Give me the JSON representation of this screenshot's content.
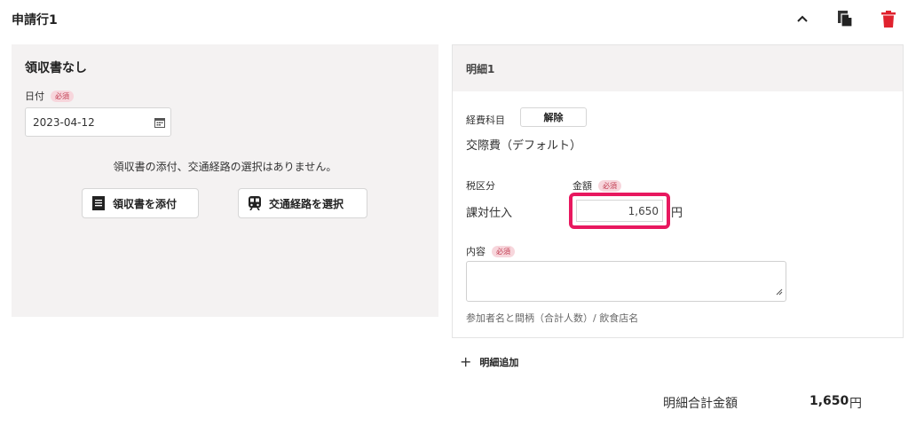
{
  "header": {
    "title": "申請行1",
    "icons": [
      "chevron-up-icon",
      "copy-icon",
      "trash-icon"
    ],
    "delete_color": "#e0222e"
  },
  "left": {
    "title": "領収書なし",
    "date_label": "日付",
    "required_badge": "必須",
    "date_value": "2023-04-12",
    "message": "領収書の添付、交通経路の選択はありません。",
    "attach_button": "領収書を添付",
    "route_button": "交通経路を選択"
  },
  "right": {
    "title": "明細1",
    "expense_label": "経費科目",
    "clear_button": "解除",
    "expense_value": "交際費（デフォルト）",
    "tax_label": "税区分",
    "amount_label": "金額",
    "required_badge": "必須",
    "tax_value": "課対仕入",
    "amount_value": "1,650",
    "amount_unit": "円",
    "highlight_color": "#e8185f",
    "content_label": "内容",
    "content_required_badge": "必須",
    "content_value": "",
    "content_hint": "参加者名と間柄（合計人数）/ 飲食店名"
  },
  "add_detail": {
    "label": "明細追加"
  },
  "total": {
    "label": "明細合計金額",
    "value": "1,650",
    "unit": "円"
  }
}
